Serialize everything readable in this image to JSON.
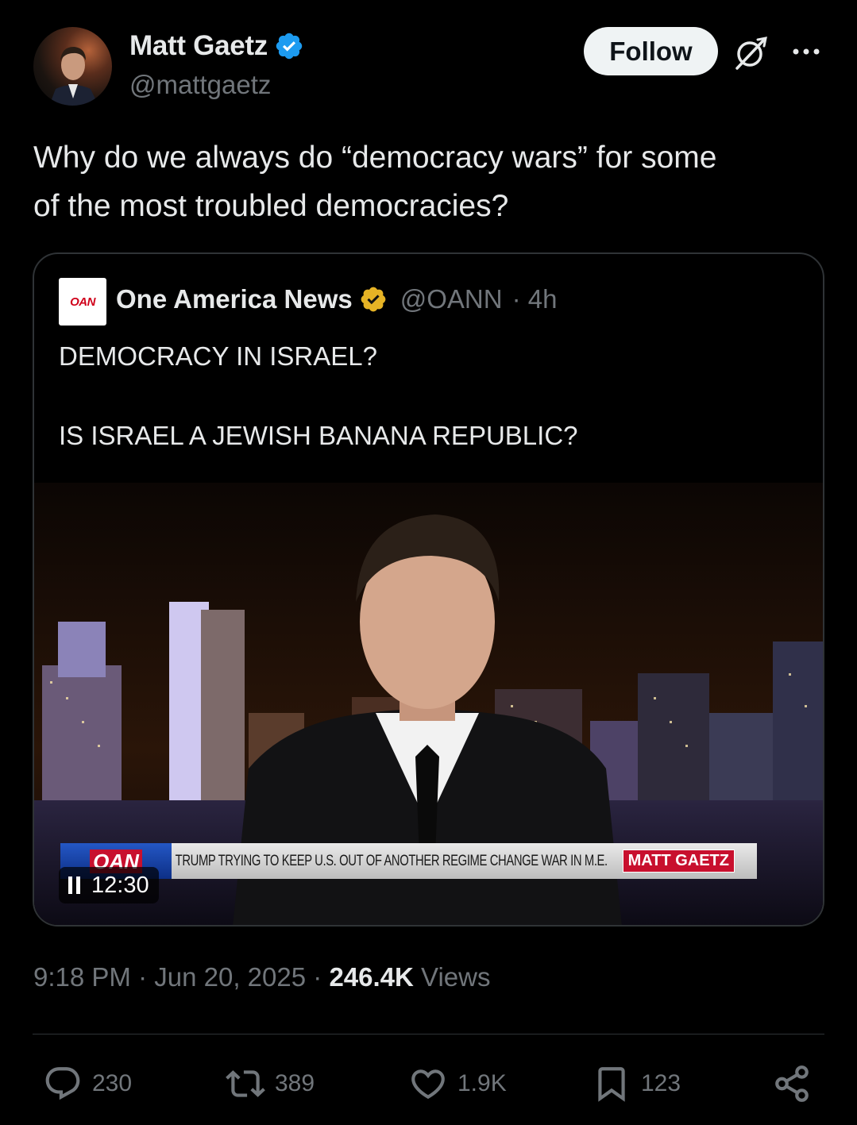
{
  "author": {
    "display_name": "Matt Gaetz",
    "handle": "@mattgaetz",
    "verified_color": "#1d9bf0"
  },
  "header": {
    "follow_label": "Follow",
    "icons": [
      "grok-icon",
      "more-icon"
    ]
  },
  "tweet": {
    "text": "Why do we always do “democracy wars” for some\nof the most troubled democracies?"
  },
  "quote": {
    "logo_text": "OAN",
    "name": "One America News",
    "handle": "@OANN",
    "time": "· 4h",
    "verified_color": "#e6b325",
    "text": "DEMOCRACY IN ISRAEL?\n\nIS ISRAEL A JEWISH BANANA REPUBLIC?",
    "video": {
      "ticker_logo": "OAN",
      "ticker_text": "TRUMP TRYING TO KEEP U.S. OUT OF ANOTHER REGIME CHANGE WAR IN M.E.",
      "show_badge": "MATT GAETZ",
      "time": "12:30"
    }
  },
  "meta": {
    "time": "9:18 PM",
    "date": "Jun 20, 2025",
    "views_count": "246.4K",
    "views_label": "Views"
  },
  "actions": {
    "replies": "230",
    "reposts": "389",
    "likes": "1.9K",
    "bookmarks": "123"
  }
}
